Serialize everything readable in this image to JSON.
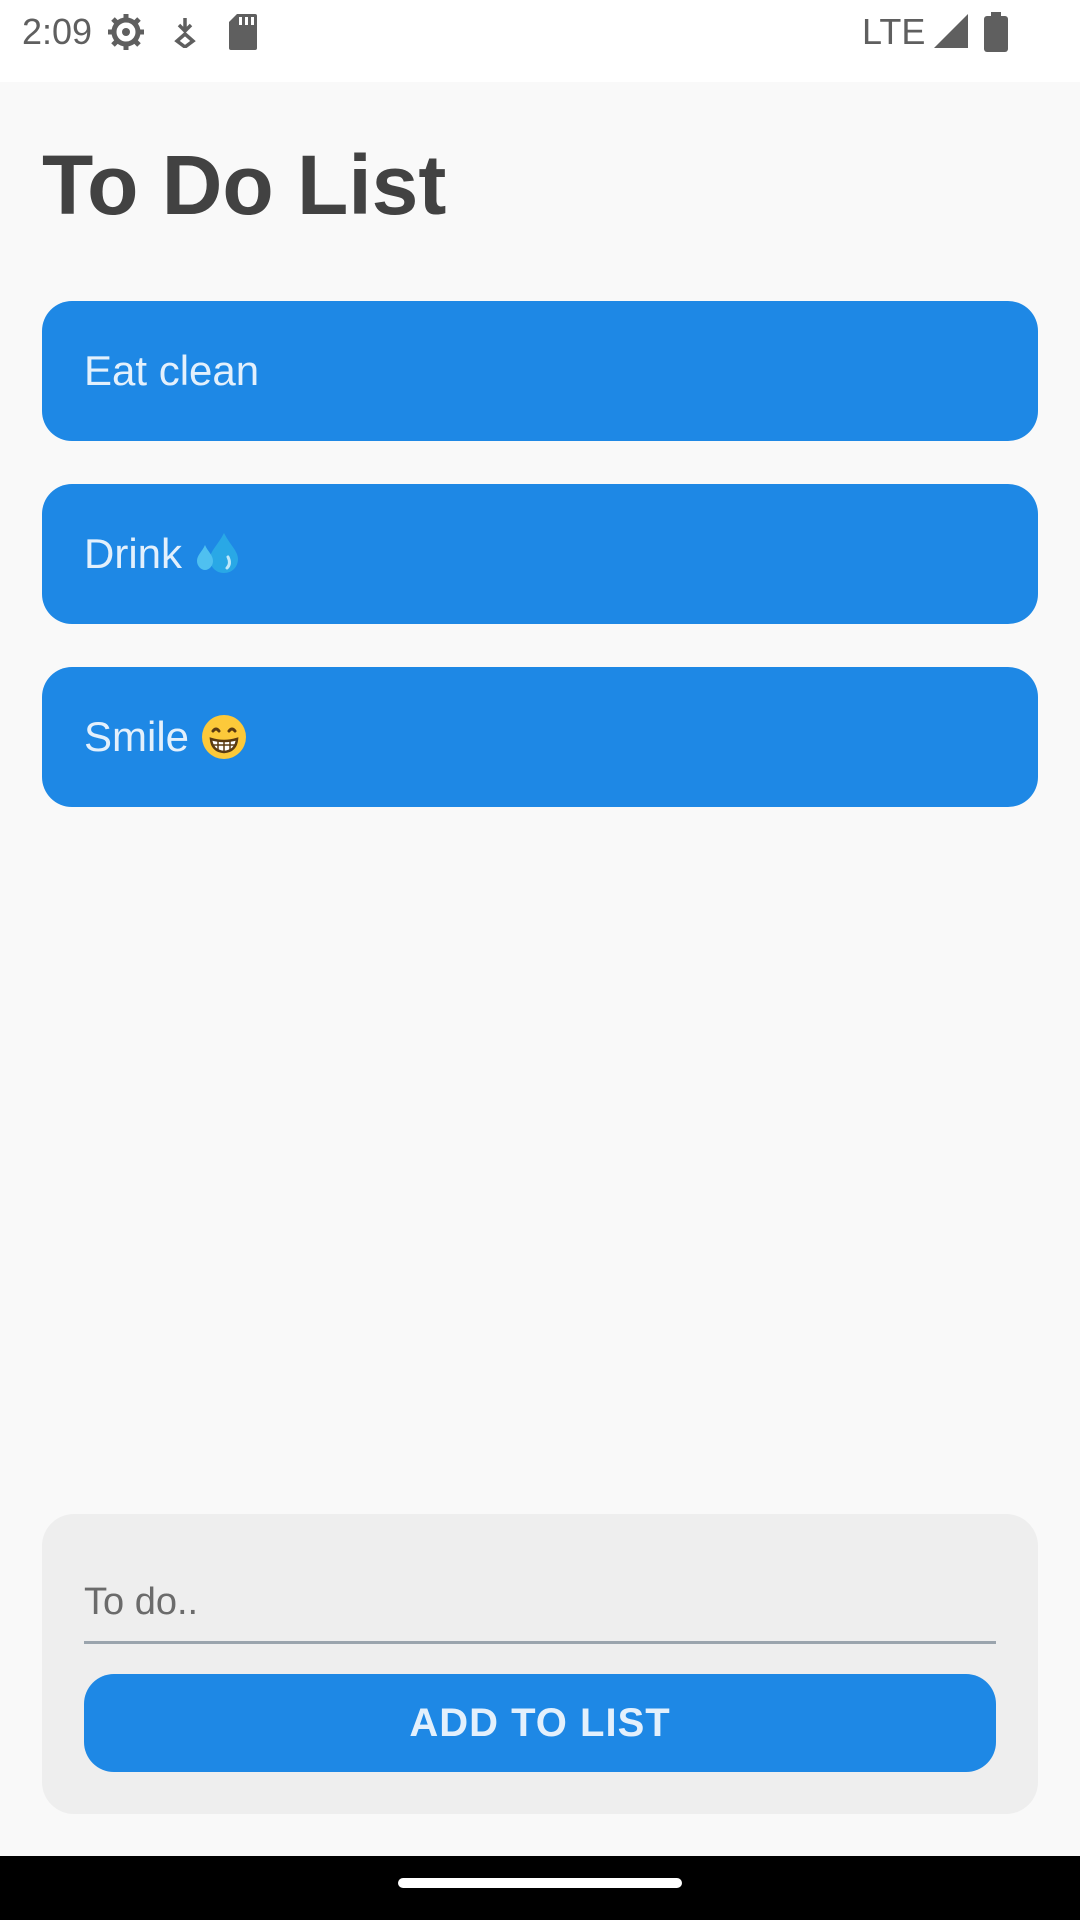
{
  "status_bar": {
    "time": "2:09",
    "network": "LTE",
    "icons": [
      "settings-icon",
      "download-icon",
      "sd-card-icon",
      "signal-icon",
      "battery-icon"
    ]
  },
  "app": {
    "title": "To Do List",
    "accent_color": "#1e88e5"
  },
  "todos": [
    {
      "text": "Eat clean",
      "emoji": ""
    },
    {
      "text": "Drink",
      "emoji": "sweat-droplets-icon"
    },
    {
      "text": "Smile",
      "emoji": "grinning-face-icon"
    }
  ],
  "form": {
    "placeholder": "To do..",
    "value": "",
    "add_label": "ADD TO LIST"
  }
}
